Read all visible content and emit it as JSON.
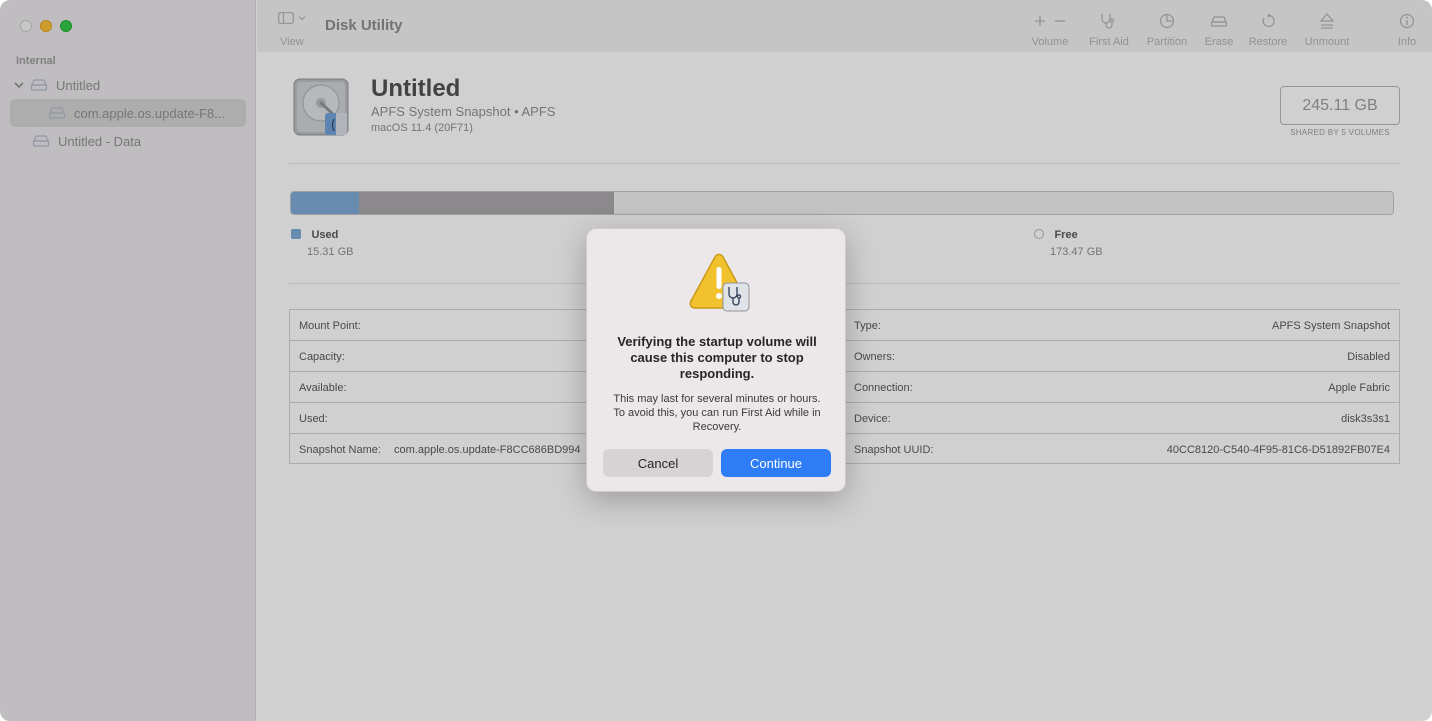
{
  "window": {
    "title": "Disk Utility"
  },
  "sidebar": {
    "section": "Internal",
    "items": [
      {
        "label": "Untitled"
      },
      {
        "label": "com.apple.os.update-F8..."
      },
      {
        "label": "Untitled - Data"
      }
    ]
  },
  "toolbar": {
    "view": "View",
    "volume": "Volume",
    "first_aid": "First Aid",
    "partition": "Partition",
    "erase": "Erase",
    "restore": "Restore",
    "unmount": "Unmount",
    "info": "Info"
  },
  "volume": {
    "name": "Untitled",
    "subtitle": "APFS System Snapshot • APFS",
    "os": "macOS 11.4 (20F71)",
    "size": "245.11 GB",
    "shared": "SHARED BY 5 VOLUMES"
  },
  "usage": {
    "used_fraction": 0.062,
    "other_fraction": 0.231,
    "used_label": "Used",
    "used_value": "15.31 GB",
    "free_label": "Free",
    "free_value": "173.47 GB"
  },
  "info_left": [
    {
      "key": "Mount Point:",
      "value": ""
    },
    {
      "key": "Capacity:",
      "value": ""
    },
    {
      "key": "Available:",
      "value": ""
    },
    {
      "key": "Used:",
      "value": ""
    },
    {
      "key": "Snapshot Name:",
      "value": "com.apple.os.update-F8CC686BD994"
    }
  ],
  "info_right": [
    {
      "key": "Type:",
      "value": "APFS System Snapshot"
    },
    {
      "key": "Owners:",
      "value": "Disabled"
    },
    {
      "key": "Connection:",
      "value": "Apple Fabric"
    },
    {
      "key": "Device:",
      "value": "disk3s3s1"
    },
    {
      "key": "Snapshot UUID:",
      "value": "40CC8120-C540-4F95-81C6-D51892FB07E4"
    }
  ],
  "alert": {
    "title": "Verifying the startup volume will cause this computer to stop responding.",
    "message": "This may last for several minutes or hours. To avoid this, you can run First Aid while in Recovery.",
    "cancel": "Cancel",
    "continue": "Continue"
  },
  "colors": {
    "accent": "#2f7df6",
    "used": "#79a8d6",
    "other": "#a7a5a7"
  }
}
